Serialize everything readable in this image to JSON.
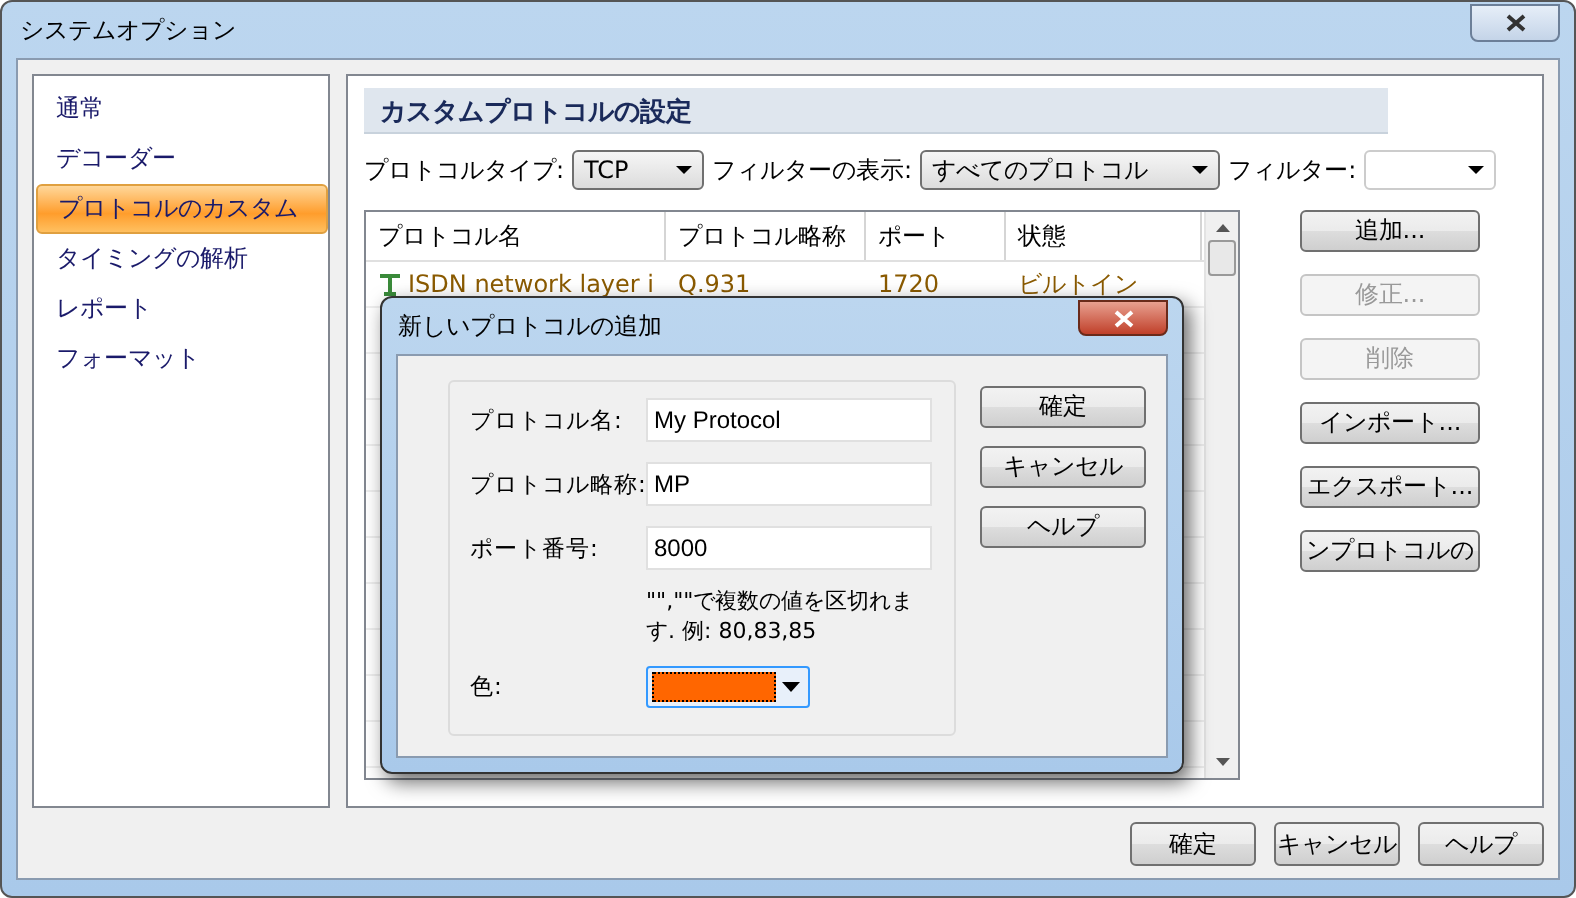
{
  "window": {
    "title": "システムオプション"
  },
  "sidebar": {
    "items": [
      {
        "label": "通常",
        "selected": false
      },
      {
        "label": "デコーダー",
        "selected": false
      },
      {
        "label": "プロトコルのカスタム",
        "selected": true
      },
      {
        "label": "タイミングの解析",
        "selected": false
      },
      {
        "label": "レポート",
        "selected": false
      },
      {
        "label": "フォーマット",
        "selected": false
      }
    ]
  },
  "section_title": "カスタムプロトコルの設定",
  "toolbar": {
    "protocol_type_label": "プロトコルタイプ:",
    "protocol_type": "TCP",
    "filter_display_label": "フィルターの表示:",
    "filter_display": "すべてのプロトコル",
    "filter_label": "フィルター:"
  },
  "table": {
    "columns": [
      "プロトコル名",
      "プロトコル略称",
      "ポート",
      "状態"
    ],
    "rows": [
      {
        "cells": [
          "ISDN network layer i",
          "Q.931",
          "1720",
          "ビルトイン"
        ]
      }
    ]
  },
  "side_buttons": [
    {
      "label": "追加...",
      "disabled": false
    },
    {
      "label": "修正...",
      "disabled": true
    },
    {
      "label": "削除",
      "disabled": true
    },
    {
      "label": "インポート...",
      "disabled": false
    },
    {
      "label": "エクスポート...",
      "disabled": false
    },
    {
      "label": "ンプロトコルの",
      "disabled": false
    }
  ],
  "dialog": {
    "title": "新しいプロトコルの追加",
    "fields": [
      {
        "label": "プロトコル名:",
        "value": "My Protocol"
      },
      {
        "label": "プロトコル略称:",
        "value": "MP"
      },
      {
        "label": "ポート番号:",
        "value": "8000"
      }
    ],
    "hint": "\"\",\"\"で複数の値を区切れます. 例: 80,83,85",
    "color_label": "色:",
    "color": "#ff6600",
    "buttons": [
      "確定",
      "キャンセル",
      "ヘルプ"
    ]
  },
  "footer_buttons": [
    "確定",
    "キャンセル",
    "ヘルプ"
  ]
}
